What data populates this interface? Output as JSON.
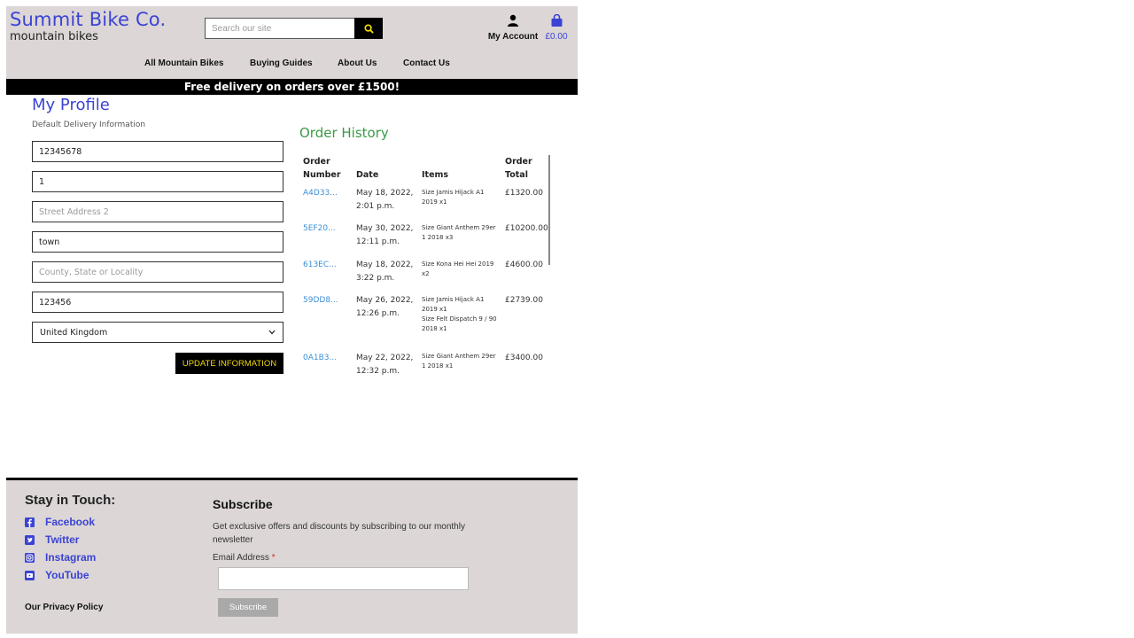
{
  "brand": {
    "title": "Summit Bike Co.",
    "subtitle": "mountain bikes",
    "accent": "#3a43d4"
  },
  "search": {
    "placeholder": "Search our site"
  },
  "account": {
    "label": "My Account"
  },
  "bag": {
    "total": "£0.00"
  },
  "nav": [
    "All Mountain Bikes",
    "Buying Guides",
    "About Us",
    "Contact Us"
  ],
  "banner": {
    "text": "Free delivery on orders over £1500!"
  },
  "profile": {
    "title": "My Profile",
    "subtitle": "Default Delivery Information",
    "fields": [
      {
        "value": "12345678",
        "placeholder": ""
      },
      {
        "value": "1",
        "placeholder": ""
      },
      {
        "value": "",
        "placeholder": "Street Address 2"
      },
      {
        "value": "town",
        "placeholder": ""
      },
      {
        "value": "",
        "placeholder": "County, State or Locality"
      },
      {
        "value": "123456",
        "placeholder": ""
      }
    ],
    "country": "United Kingdom",
    "update_label": "UPDATE INFORMATION"
  },
  "order_history": {
    "title": "Order History",
    "columns": {
      "number": [
        "Order",
        "Number"
      ],
      "date": "Date",
      "items": "Items",
      "total": [
        "Order",
        "Total"
      ]
    },
    "orders": [
      {
        "number": "A4D33...",
        "date": [
          "May 18, 2022,",
          "2:01 p.m."
        ],
        "items": [
          "Size Jamis Hijack A1",
          "2019 x1"
        ],
        "total": "£1320.00"
      },
      {
        "number": "5EF20...",
        "date": [
          "May 30, 2022,",
          "12:11 p.m."
        ],
        "items": [
          "Size Giant Anthem 29er",
          "1 2018 x3"
        ],
        "total": "£10200.00"
      },
      {
        "number": "613EC...",
        "date": [
          "May 18, 2022,",
          "3:22 p.m."
        ],
        "items": [
          "Size Kona Hei Hei 2019",
          "x2"
        ],
        "total": "£4600.00"
      },
      {
        "number": "59DD8...",
        "date": [
          "May 26, 2022,",
          "12:26 p.m."
        ],
        "items": [
          "Size Jamis Hijack A1",
          "2019 x1",
          "Size Felt Dispatch 9 / 90",
          "2018 x1"
        ],
        "total": "£2739.00"
      },
      {
        "number": "0A1B3...",
        "date": [
          "May 22, 2022,",
          "12:32 p.m."
        ],
        "items": [
          "Size Giant Anthem 29er",
          "1 2018 x1"
        ],
        "total": "£3400.00"
      }
    ]
  },
  "footer": {
    "stay_title": "Stay in Touch:",
    "social": [
      "Facebook",
      "Twitter",
      "Instagram",
      "YouTube"
    ],
    "privacy": "Our Privacy Policy",
    "subscribe_title": "Subscribe",
    "subscribe_text": "Get exclusive offers and discounts by subscribing to our monthly newsletter",
    "email_label": "Email Address",
    "required_mark": "*",
    "subscribe_button": "Subscribe"
  }
}
